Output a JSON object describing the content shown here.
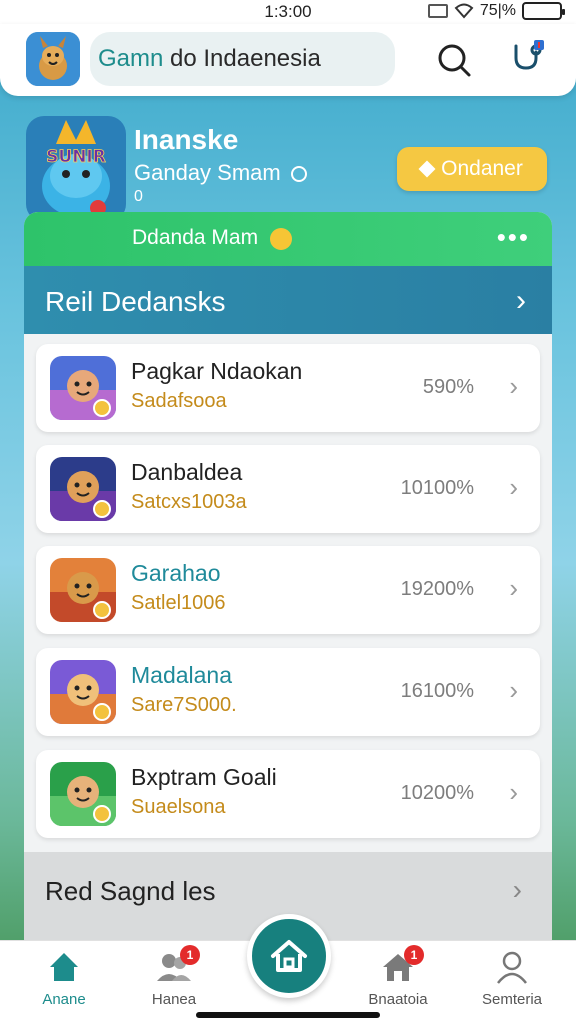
{
  "status_bar": {
    "time": "1:3:00",
    "battery_text": "75|%",
    "battery_level": 0.75,
    "colors": {
      "battery": "#2fb34a"
    }
  },
  "header": {
    "search_text_teal": "Gamn",
    "search_text_rest": " do Indaenesia",
    "icons": [
      "app-logo",
      "search-icon",
      "stethoscope-icon"
    ]
  },
  "profile": {
    "avatar_text": "SUNIR",
    "name": "Inanske",
    "subtitle": "Ganday Smam",
    "subtitle_extra": "0",
    "order_button": "Ondaner"
  },
  "panel": {
    "green_bar_label": "Ddanda Mam",
    "green_bar_menu": "•••",
    "section_title": "Reil Dedansks",
    "items": [
      {
        "name": "Pagkar Ndaokan",
        "sub": "Sadafsooa",
        "percent": "590%",
        "name_teal": false
      },
      {
        "name": "Danbaldea",
        "sub": "Satcxs1003a",
        "percent": "10100%",
        "name_teal": false
      },
      {
        "name": "Garahao",
        "sub": "Satlel1006",
        "percent": "19200%",
        "name_teal": true
      },
      {
        "name": "Madalana",
        "sub": "Sare7S000.",
        "percent": "16100%",
        "name_teal": true
      },
      {
        "name": "Bxptram Goali",
        "sub": "Suaelsona",
        "percent": "10200%",
        "name_teal": false
      }
    ],
    "footer_title": "Red Sagnd les"
  },
  "bottom_nav": {
    "items": [
      {
        "label": "Anane",
        "icon": "home-icon",
        "badge": ""
      },
      {
        "label": "Hanea",
        "icon": "users-icon",
        "badge": "1"
      },
      {
        "label": "Bnaatoia",
        "icon": "house-notify-icon",
        "badge": "1"
      },
      {
        "label": "Semteria",
        "icon": "profile-icon",
        "badge": ""
      }
    ]
  },
  "colors": {
    "accent_teal": "#1d8c8c",
    "green_bar": "#2ec36a",
    "section_bar": "#2f8eae",
    "order_button": "#f5c842",
    "subtext_gold": "#c48b1b"
  }
}
